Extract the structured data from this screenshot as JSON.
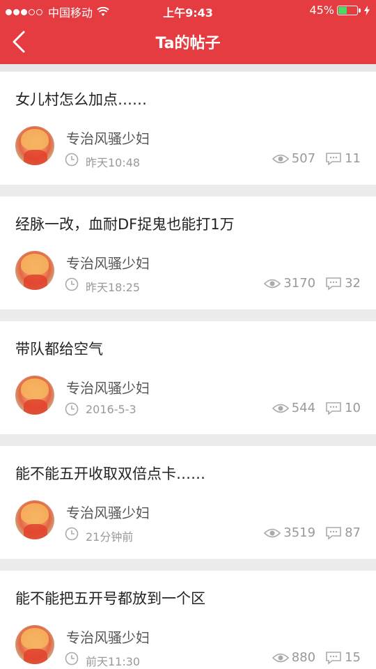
{
  "status_bar": {
    "carrier": "中国移动",
    "time": "上午9:43",
    "battery_percent": "45%",
    "battery_level": 0.45
  },
  "header": {
    "title": "Ta的帖子",
    "color": "#e43c40"
  },
  "posts": [
    {
      "title": "女儿村怎么加点……",
      "author": "专治风骚少妇",
      "time": "昨天10:48",
      "views": "507",
      "comments": "11"
    },
    {
      "title": "经脉一改，血耐DF捉鬼也能打1万",
      "author": "专治风骚少妇",
      "time": "昨天18:25",
      "views": "3170",
      "comments": "32"
    },
    {
      "title": "带队都给空气",
      "author": "专治风骚少妇",
      "time": "2016-5-3",
      "views": "544",
      "comments": "10"
    },
    {
      "title": "能不能五开收取双倍点卡……",
      "author": "专治风骚少妇",
      "time": "21分钟前",
      "views": "3519",
      "comments": "87"
    },
    {
      "title": "能不能把五开号都放到一个区",
      "author": "专治风骚少妇",
      "time": "前天11:30",
      "views": "880",
      "comments": "15"
    }
  ]
}
